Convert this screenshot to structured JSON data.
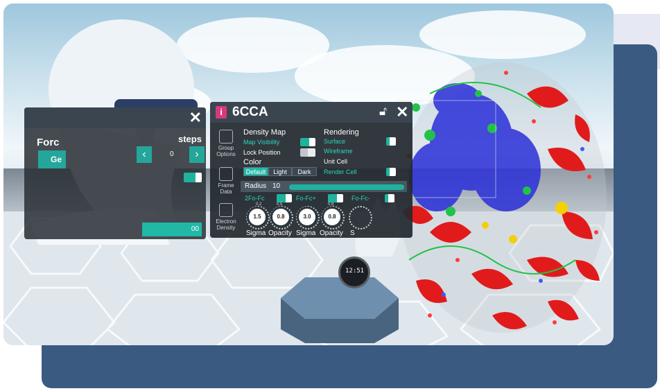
{
  "scene_panel": {
    "title": "6CCA",
    "sidebar": [
      {
        "label_line1": "Group",
        "label_line2": "Options",
        "icon": "group-options-icon"
      },
      {
        "label_line1": "Frame",
        "label_line2": "Data",
        "icon": "frame-data-icon"
      },
      {
        "label_line1": "Electron",
        "label_line2": "Density",
        "icon": "electron-density-icon"
      }
    ],
    "density_map": {
      "heading": "Density Map",
      "map_visibility": "Map Visibility",
      "lock_position": "Lock Position",
      "color_heading": "Color",
      "color_options": [
        "Default",
        "Light",
        "Dark"
      ],
      "color_selected": "Default"
    },
    "rendering": {
      "heading": "Rendering",
      "surface": "Surface",
      "wireframe": "Wireframe",
      "unit_cell": "Unit Cell",
      "render_cell": "Render Cell"
    },
    "radius": {
      "label": "Radius",
      "value": "10",
      "fill": 0.95
    },
    "maps": [
      {
        "name": "2Fo-Fc",
        "enabled": true,
        "sigma": "1.5",
        "opacity": "0.8"
      },
      {
        "name": "Fo-Fc+",
        "enabled": true,
        "sigma": "3.0",
        "opacity": "0.8"
      },
      {
        "name": "Fo-Fc-",
        "enabled": true
      }
    ],
    "knob_labels": {
      "sigma": "Sigma",
      "opacity": "Opacity",
      "short": "S"
    },
    "ticks": {
      "a": "0.8",
      "b": "0.5",
      "c": "0.2"
    }
  },
  "left_panel": {
    "title_partial": "Forc",
    "steps_label": "steps",
    "item_partial": "Ge",
    "value_partial": "0",
    "bottom_partial": "00"
  },
  "watch": {
    "display": "12:51"
  },
  "colors": {
    "accent": "#1fb39e",
    "frame": "#3b5a82",
    "helix": "#e11b1b",
    "density": "#2a2fd8"
  }
}
